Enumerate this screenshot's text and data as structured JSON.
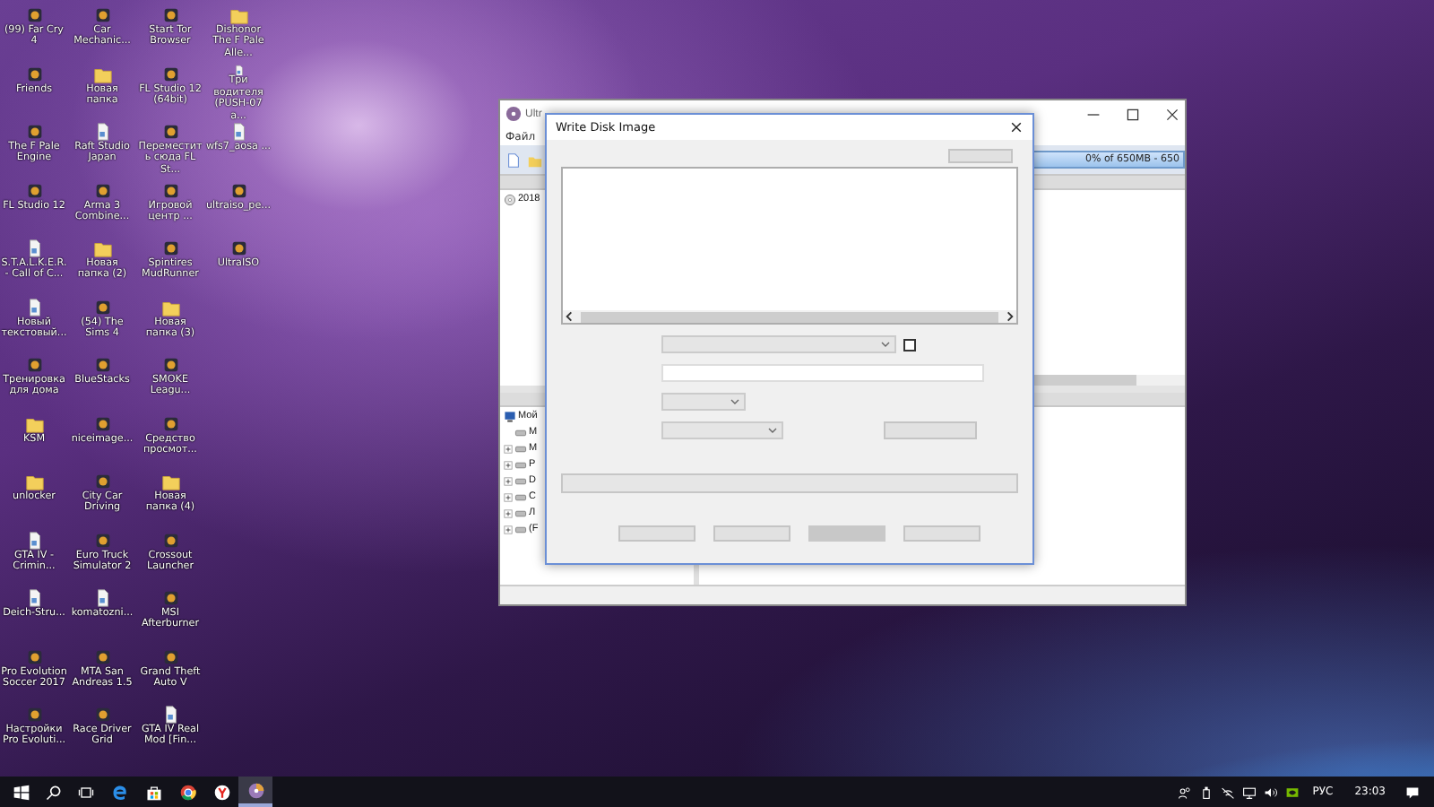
{
  "desktop": {
    "icons": [
      {
        "label": "(99) Far Cry 4",
        "kind": "app"
      },
      {
        "label": "Friends",
        "kind": "app"
      },
      {
        "label": "The F Pale Engine",
        "kind": "app"
      },
      {
        "label": "FL Studio 12",
        "kind": "app"
      },
      {
        "label": "S.T.A.L.K.E.R. - Call of C...",
        "kind": "file"
      },
      {
        "label": "Новый текстовый...",
        "kind": "file"
      },
      {
        "label": "Тренировка для дома",
        "kind": "app"
      },
      {
        "label": "KSM",
        "kind": "folder"
      },
      {
        "label": "unlocker",
        "kind": "folder"
      },
      {
        "label": "GTA IV -Crimin...",
        "kind": "file"
      },
      {
        "label": "Deich-Stru...",
        "kind": "file"
      },
      {
        "label": "Pro Evolution Soccer 2017",
        "kind": "app"
      },
      {
        "label": "Настройки Pro Evoluti...",
        "kind": "app"
      },
      {
        "label": "Car Mechanic...",
        "kind": "app"
      },
      {
        "label": "Новая папка",
        "kind": "folder"
      },
      {
        "label": "Raft Studio Japan",
        "kind": "file"
      },
      {
        "label": "Arma 3 Combine...",
        "kind": "app"
      },
      {
        "label": "Новая папка (2)",
        "kind": "folder"
      },
      {
        "label": "(54) The Sims 4",
        "kind": "app"
      },
      {
        "label": "BlueStacks",
        "kind": "app"
      },
      {
        "label": "niceimage...",
        "kind": "app"
      },
      {
        "label": "City Car Driving",
        "kind": "app"
      },
      {
        "label": "Euro Truck Simulator 2",
        "kind": "app"
      },
      {
        "label": "komatozni...",
        "kind": "file"
      },
      {
        "label": "MTA San Andreas 1.5",
        "kind": "app"
      },
      {
        "label": "Race Driver Grid",
        "kind": "app"
      },
      {
        "label": "Start Tor Browser",
        "kind": "app"
      },
      {
        "label": "FL Studio 12 (64bit)",
        "kind": "app"
      },
      {
        "label": "Переместить сюда FL St...",
        "kind": "app"
      },
      {
        "label": "Игровой центр ...",
        "kind": "app"
      },
      {
        "label": "Spintires MudRunner",
        "kind": "app"
      },
      {
        "label": "Новая папка (3)",
        "kind": "folder"
      },
      {
        "label": "SMOKE Leagu...",
        "kind": "app"
      },
      {
        "label": "Средство просмот...",
        "kind": "app"
      },
      {
        "label": "Новая папка (4)",
        "kind": "folder"
      },
      {
        "label": "Crossout Launcher",
        "kind": "app"
      },
      {
        "label": "MSI Afterburner",
        "kind": "app"
      },
      {
        "label": "Grand Theft Auto V",
        "kind": "app"
      },
      {
        "label": "GTA IV Real Mod [Fin...",
        "kind": "file"
      },
      {
        "label": "Dishonor The F Pale Alle...",
        "kind": "folder"
      },
      {
        "label": "Три водителя (PUSH-07 a...",
        "kind": "file"
      },
      {
        "label": "wfs7_aosa ...",
        "kind": "file"
      },
      {
        "label": "ultraiso_pe...",
        "kind": "app"
      },
      {
        "label": "UltraISO",
        "kind": "app"
      }
    ]
  },
  "main_window": {
    "title": "Ultr",
    "menu": [
      "Файл"
    ],
    "capacity": "0% of 650MB - 650",
    "image_items": [
      "2018"
    ],
    "tree": {
      "label": "Мой",
      "children": [
        {
          "label": "М",
          "expandable": false
        },
        {
          "label": "М",
          "expandable": true
        },
        {
          "label": "Р",
          "expandable": true
        },
        {
          "label": "D",
          "expandable": true
        },
        {
          "label": "C",
          "expandable": true
        },
        {
          "label": "Л",
          "expandable": true
        },
        {
          "label": "(F",
          "expandable": true
        }
      ]
    }
  },
  "dialog": {
    "title": "Write Disk Image",
    "checkbox": {
      "checked": false
    },
    "progress": {
      "level": 0
    },
    "buttons": [
      {
        "selected": false
      },
      {
        "selected": false
      },
      {
        "selected": true
      },
      {
        "selected": false
      }
    ]
  },
  "taskbar": {
    "apps": [
      {
        "kind": "letter-e",
        "active": false
      },
      {
        "kind": "bag",
        "active": false
      },
      {
        "kind": "ring",
        "active": false
      },
      {
        "kind": "letter-y",
        "active": false
      },
      {
        "kind": "disc",
        "active": true
      }
    ],
    "language": "РУС",
    "time": "23:03"
  }
}
